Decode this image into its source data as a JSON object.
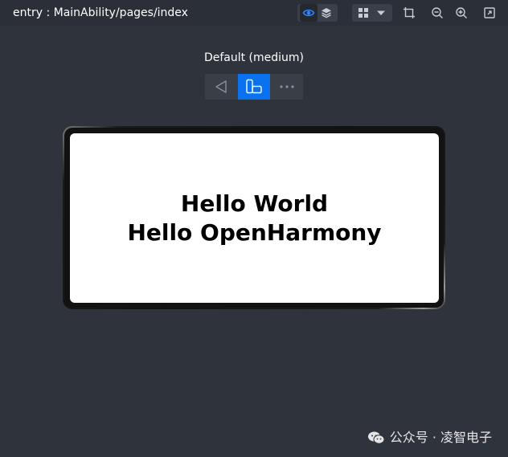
{
  "header": {
    "path": "entry : MainAbility/pages/index"
  },
  "toolbar": {
    "icons": [
      "inspector-eye-icon",
      "layers-icon",
      "grid-icon",
      "dropdown-arrow-icon",
      "crop-icon",
      "zoom-out-icon",
      "zoom-in-icon",
      "fit-screen-icon"
    ],
    "accent": "#1f6fe5"
  },
  "device": {
    "label": "Default (medium)",
    "orientation_options": [
      "back-triangle-icon",
      "rotate-device-icon",
      "more-icon"
    ],
    "selected_index": 1,
    "selected_color": "#0a72ef"
  },
  "screen": {
    "line1": "Hello World",
    "line2": "Hello OpenHarmony"
  },
  "watermark": {
    "text": "公众号 · 凌智电子"
  }
}
